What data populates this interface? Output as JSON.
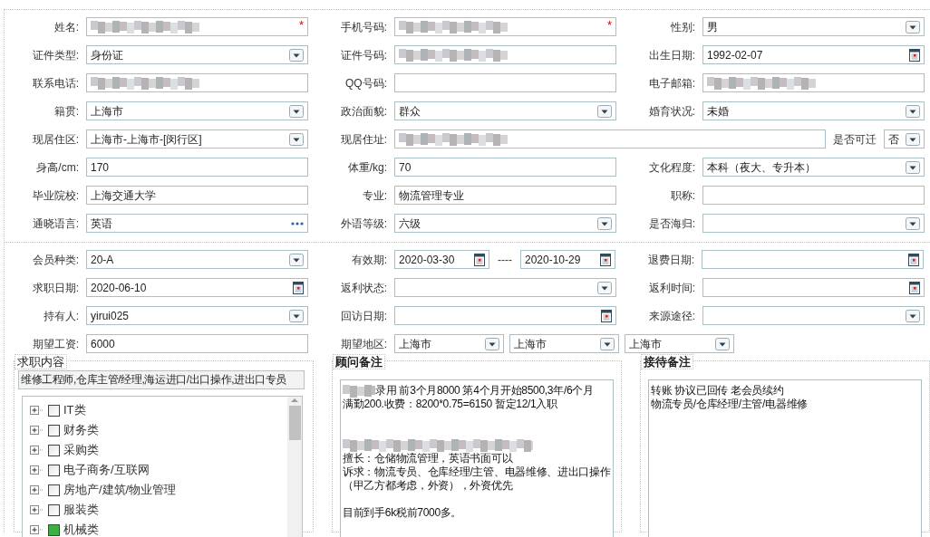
{
  "sections": [
    {
      "rows": [
        [
          {
            "label": "姓名:",
            "controls": [
              {
                "kind": "text",
                "redacted": true,
                "required_mark": "*"
              }
            ]
          },
          {
            "label": "手机号码:",
            "controls": [
              {
                "kind": "text",
                "redacted": true,
                "required_mark": "*"
              }
            ]
          },
          {
            "label": "性别:",
            "controls": [
              {
                "kind": "select",
                "value": "男"
              }
            ]
          }
        ],
        [
          {
            "label": "证件类型:",
            "controls": [
              {
                "kind": "select",
                "value": "身份证"
              }
            ]
          },
          {
            "label": "证件号码:",
            "controls": [
              {
                "kind": "text",
                "redacted": true
              }
            ]
          },
          {
            "label": "出生日期:",
            "controls": [
              {
                "kind": "date",
                "value": "1992-02-07"
              }
            ]
          }
        ],
        [
          {
            "label": "联系电话:",
            "controls": [
              {
                "kind": "text",
                "redacted": true
              }
            ]
          },
          {
            "label": "QQ号码:",
            "controls": [
              {
                "kind": "text"
              }
            ]
          },
          {
            "label": "电子邮箱:",
            "controls": [
              {
                "kind": "text",
                "redacted": true
              }
            ]
          }
        ],
        [
          {
            "label": "籍贯:",
            "controls": [
              {
                "kind": "select",
                "value": "上海市"
              }
            ]
          },
          {
            "label": "政治面貌:",
            "controls": [
              {
                "kind": "select",
                "value": "群众"
              }
            ]
          },
          {
            "label": "婚育状况:",
            "controls": [
              {
                "kind": "select",
                "value": "未婚"
              }
            ]
          }
        ],
        [
          {
            "label": "现居住区:",
            "controls": [
              {
                "kind": "select",
                "value": "上海市-上海市-[闵行区]"
              }
            ]
          },
          {
            "label": "现居住址:",
            "controls": [
              {
                "kind": "text",
                "redacted": true
              }
            ]
          },
          {
            "label": "是否可迁",
            "controls": [
              {
                "kind": "select",
                "value": "否"
              }
            ]
          }
        ],
        [
          {
            "label": "身高/cm:",
            "controls": [
              {
                "kind": "text",
                "value": "170"
              }
            ]
          },
          {
            "label": "体重/kg:",
            "controls": [
              {
                "kind": "text",
                "value": "70"
              }
            ]
          },
          {
            "label": "文化程度:",
            "controls": [
              {
                "kind": "select",
                "value": "本科（夜大、专升本）"
              }
            ]
          }
        ],
        [
          {
            "label": "毕业院校:",
            "controls": [
              {
                "kind": "text",
                "value": "上海交通大学"
              }
            ]
          },
          {
            "label": "专业:",
            "controls": [
              {
                "kind": "text",
                "value": "物流管理专业"
              }
            ]
          },
          {
            "label": "职称:",
            "controls": [
              {
                "kind": "text"
              }
            ]
          }
        ],
        [
          {
            "label": "通晓语言:",
            "controls": [
              {
                "kind": "lookup",
                "value": "英语"
              }
            ]
          },
          {
            "label": "外语等级:",
            "controls": [
              {
                "kind": "select",
                "value": "六级"
              }
            ]
          },
          {
            "label": "是否海归:",
            "controls": [
              {
                "kind": "select"
              }
            ]
          }
        ]
      ]
    },
    {
      "rows": [
        [
          {
            "label": "会员种类:",
            "controls": [
              {
                "kind": "select",
                "value": "20-A"
              }
            ]
          },
          {
            "label": "有效期:",
            "controls": [
              {
                "kind": "date",
                "value": "2020-03-30"
              },
              {
                "kind": "separator",
                "value": "----"
              },
              {
                "kind": "date",
                "value": "2020-10-29"
              }
            ]
          },
          {
            "label": "退费日期:",
            "controls": [
              {
                "kind": "date"
              }
            ]
          }
        ],
        [
          {
            "label": "求职日期:",
            "controls": [
              {
                "kind": "date",
                "value": "2020-06-10"
              }
            ]
          },
          {
            "label": "返利状态:",
            "controls": [
              {
                "kind": "select"
              }
            ]
          },
          {
            "label": "返利时间:",
            "controls": [
              {
                "kind": "date"
              }
            ]
          }
        ],
        [
          {
            "label": "持有人:",
            "controls": [
              {
                "kind": "select",
                "value": "yirui025"
              }
            ]
          },
          {
            "label": "回访日期:",
            "controls": [
              {
                "kind": "date"
              }
            ]
          },
          {
            "label": "来源途径:",
            "controls": [
              {
                "kind": "select"
              }
            ]
          }
        ],
        [
          {
            "label": "期望工资:",
            "controls": [
              {
                "kind": "text",
                "value": "6000"
              }
            ]
          },
          {
            "label": "期望地区:",
            "controls": [
              {
                "kind": "select",
                "value": "上海市"
              },
              {
                "kind": "select",
                "value": "上海市"
              },
              {
                "kind": "select",
                "value": "上海市"
              }
            ]
          }
        ]
      ]
    }
  ],
  "job_intent": {
    "legend": "求职内容",
    "selected_text": "维修工程师,仓库主管/经理,海运进口/出口操作,进出口专员",
    "tree": [
      {
        "label": "IT类",
        "expanded": false,
        "checked": false
      },
      {
        "label": "财务类",
        "expanded": false,
        "checked": false
      },
      {
        "label": "采购类",
        "expanded": false,
        "checked": false
      },
      {
        "label": "电子商务/互联网",
        "expanded": false,
        "checked": false
      },
      {
        "label": "房地产/建筑/物业管理",
        "expanded": false,
        "checked": false
      },
      {
        "label": "服装类",
        "expanded": false,
        "checked": false
      },
      {
        "label": "机械类",
        "expanded": false,
        "checked": true
      }
    ]
  },
  "notes": [
    {
      "legend": "顾问备注",
      "lines": [
        {
          "kind": "text",
          "redacted_prefix": true,
          "text": "录用 前3个月8000 第4个月开始8500,3年/6个月"
        },
        {
          "kind": "text",
          "text": "满勤200.收费：8200*0.75=6150    暂定12/1入职"
        },
        {
          "kind": "blank"
        },
        {
          "kind": "blank"
        },
        {
          "kind": "redacted"
        },
        {
          "kind": "text",
          "text": "擅长：仓储物流管理，英语书面可以"
        },
        {
          "kind": "text",
          "text": "诉求：物流专员、仓库经理/主管、电器维修、进出口操作（甲乙方都考虑，外资），外资优先"
        },
        {
          "kind": "blank"
        },
        {
          "kind": "text",
          "text": "目前到手6k税前7000多。"
        }
      ]
    },
    {
      "legend": "接待备注",
      "lines": [
        {
          "kind": "text",
          "text": "转账 协议已回传 老会员续约"
        },
        {
          "kind": "text",
          "text": "物流专员/仓库经理/主管/电器维修"
        }
      ]
    }
  ]
}
